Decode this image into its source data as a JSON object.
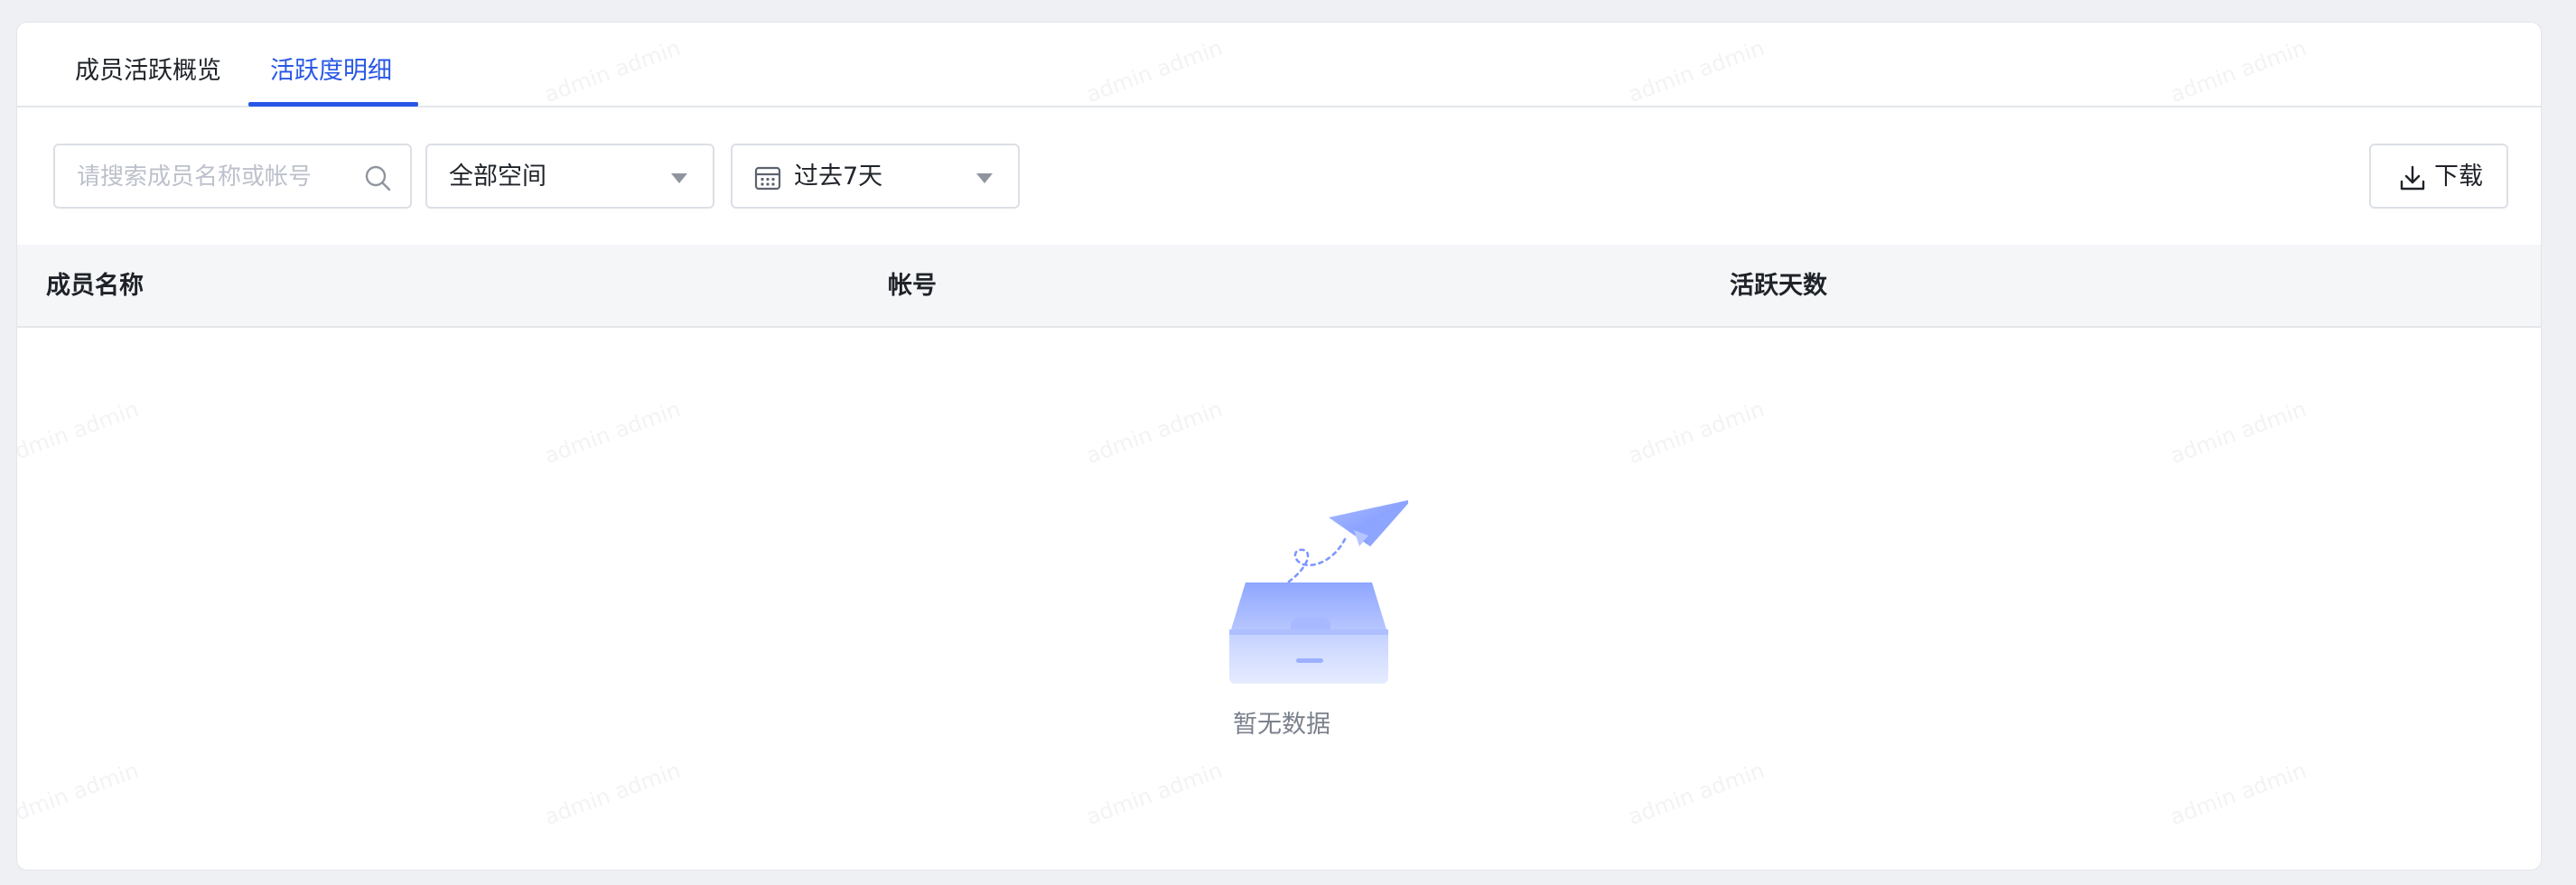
{
  "tabs": [
    {
      "label": "成员活跃概览",
      "active": false
    },
    {
      "label": "活跃度明细",
      "active": true
    }
  ],
  "toolbar": {
    "search_placeholder": "请搜索成员名称或帐号",
    "space_select": "全部空间",
    "date_select": "过去7天",
    "download_label": "下载"
  },
  "table": {
    "columns": [
      "成员名称",
      "帐号",
      "活跃天数"
    ]
  },
  "empty_state": {
    "text": "暂无数据"
  },
  "watermark": "admin admin",
  "colors": {
    "accent": "#2857e6",
    "background": "#eef0f3",
    "header_bg": "#f5f6f8"
  },
  "icons": {
    "search": "search-icon",
    "calendar": "calendar-icon",
    "caret": "chevron-down-icon",
    "download": "download-icon",
    "empty": "empty-box-icon"
  }
}
